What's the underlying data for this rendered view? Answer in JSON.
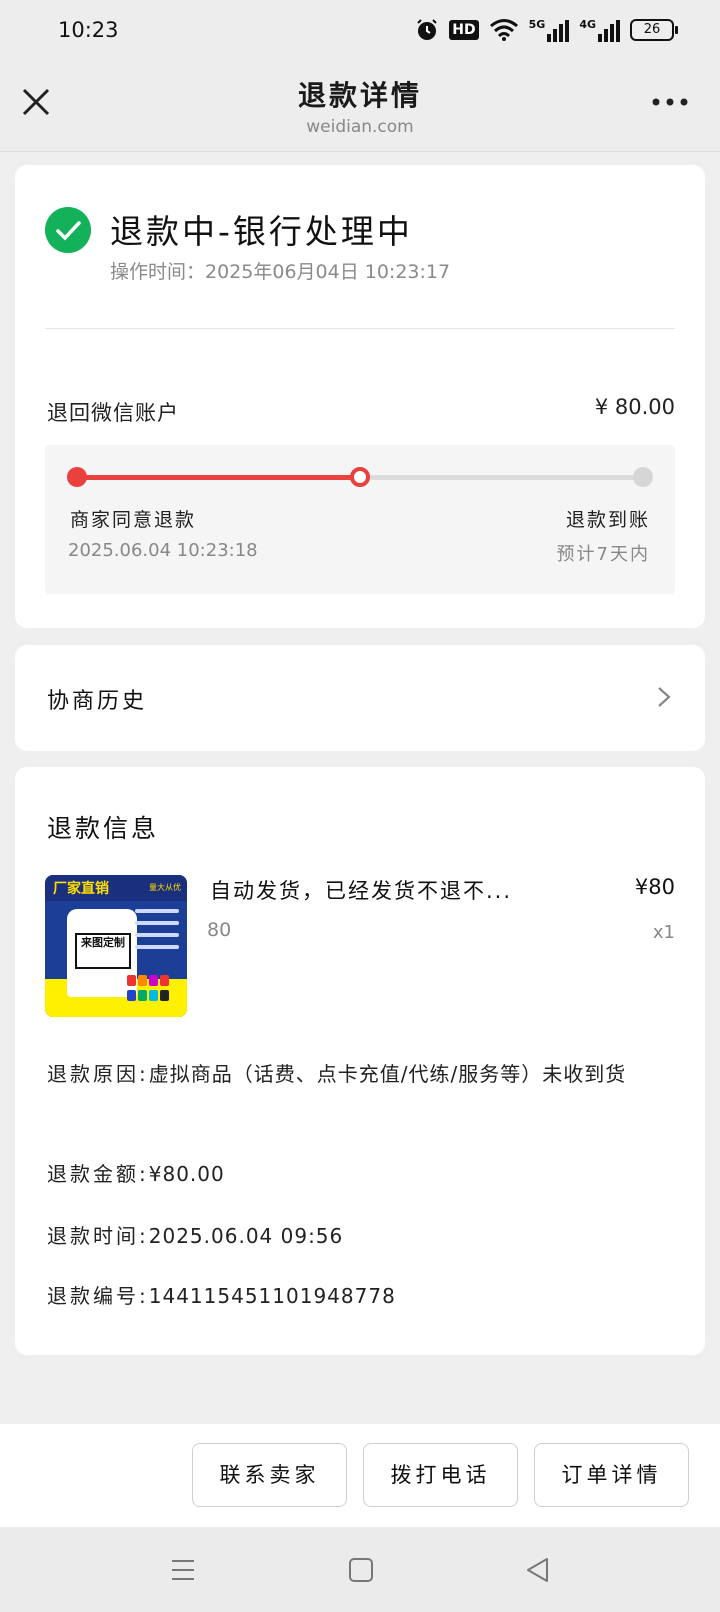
{
  "status_bar": {
    "time": "10:23",
    "hd_label": "HD",
    "signal1_label": "5G",
    "signal2_label": "4G",
    "battery": "26"
  },
  "nav": {
    "title": "退款详情",
    "subtitle": "weidian.com"
  },
  "status": {
    "title": "退款中-银行处理中",
    "op_time": "操作时间：2025年06月04日 10:23:17",
    "refund_to": "退回微信账户",
    "amount": "¥ 80.00"
  },
  "progress": {
    "fraction": 0.5,
    "step1_label": "商家同意退款",
    "step1_time": "2025.06.04 10:23:18",
    "step2_label": "退款到账",
    "step2_sub": "预计7天内"
  },
  "history": {
    "label": "协商历史"
  },
  "refund_info": {
    "section_title": "退款信息",
    "product": {
      "thumb_banner": "厂家直销",
      "thumb_banner_right": "量大从优",
      "thumb_center": "来图定制",
      "title": "自动发货，已经发货不退不...",
      "price": "¥80",
      "spec": "80",
      "qty": "x1"
    },
    "reason_key": "退款原因:",
    "reason_value": "虚拟商品（话费、点卡充值/代练/服务等）未收到货",
    "amount_key": "退款金额:",
    "amount_value": "¥80.00",
    "time_key": "退款时间:",
    "time_value": "2025.06.04 09:56",
    "id_key": "退款编号:",
    "id_value": "144115451101948778"
  },
  "actions": {
    "contact": "联系卖家",
    "call": "拨打电话",
    "order": "订单详情"
  },
  "colors": {
    "accent": "#e8413e",
    "success": "#13b25a"
  }
}
